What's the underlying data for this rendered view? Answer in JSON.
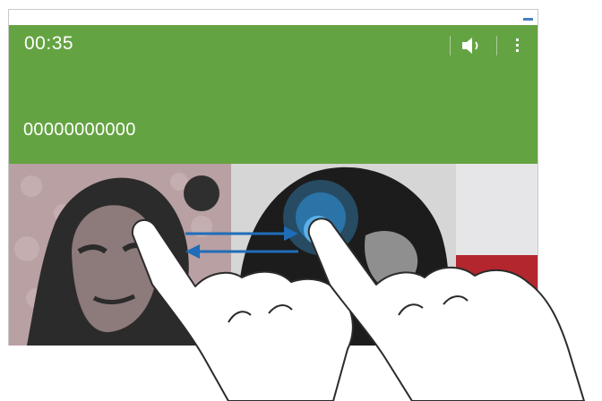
{
  "call": {
    "timer": "00:35",
    "number": "00000000000"
  },
  "icons": {
    "speaker": "speaker-icon",
    "more": "more-options-icon",
    "swap": "swap-arrows-icon",
    "touch": "touch-highlight-icon"
  },
  "colors": {
    "header_green": "#64a342",
    "arrow_blue": "#1f6db8",
    "side_red": "#b3262e",
    "status_dash": "#4a7fc1"
  }
}
